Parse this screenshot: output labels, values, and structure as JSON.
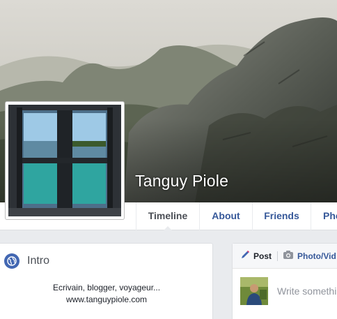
{
  "profile": {
    "name": "Tanguy Piole"
  },
  "nav": {
    "tabs": [
      {
        "label": "Timeline",
        "active": true
      },
      {
        "label": "About",
        "active": false
      },
      {
        "label": "Friends",
        "active": false
      },
      {
        "label": "Pho",
        "active": false
      }
    ]
  },
  "intro": {
    "title": "Intro",
    "icon": "globe-icon",
    "bio_line1": "Ecrivain, blogger, voyageur...",
    "bio_line2": "www.tanguypiole.com"
  },
  "composer": {
    "post_label": "Post",
    "photo_label": "Photo/Vid",
    "placeholder": "Write somethi"
  },
  "colors": {
    "link": "#365899",
    "background": "#e9ebee",
    "brand": "#4267b2"
  }
}
